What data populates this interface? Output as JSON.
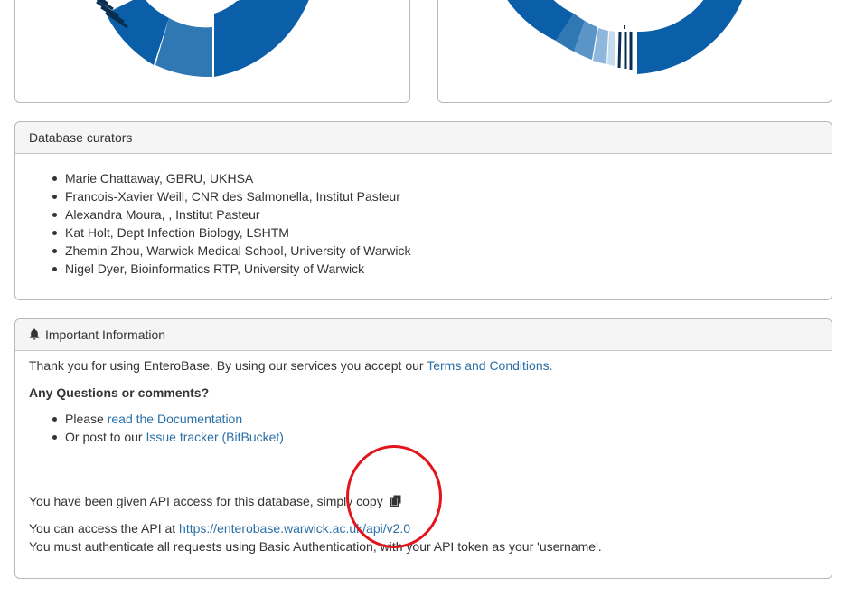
{
  "curators_panel": {
    "heading": "Database curators",
    "items": [
      "Marie Chattaway, GBRU, UKHSA",
      "Francois-Xavier Weill, CNR des Salmonella, Institut Pasteur",
      "Alexandra Moura, , Institut Pasteur",
      "Kat Holt, Dept Infection Biology, LSHTM",
      "Zhemin Zhou, Warwick Medical School, University of Warwick",
      "Nigel Dyer, Bioinformatics RTP, University of Warwick"
    ]
  },
  "info_panel": {
    "heading": "Important Information",
    "heading_icon": "bell-icon",
    "thanks_text": "Thank you for using EnteroBase. By using our services you accept our ",
    "terms_link": "Terms and Conditions.",
    "questions_heading": "Any Questions or comments?",
    "list": [
      {
        "prefix": "Please ",
        "link": "read the Documentation"
      },
      {
        "prefix": "Or post to our ",
        "link": "Issue tracker (BitBucket)"
      }
    ],
    "api_access_text": "You have been given API access for this database, simply copy",
    "copy_icon": "copy-icon",
    "api_url_prefix": "You can access the API at ",
    "api_url": "https://enterobase.warwick.ac.uk/api/v2.0",
    "auth_text": "You must authenticate all requests using Basic Authentication, with your API token as your 'username'."
  },
  "colors": {
    "link": "#2a6ea6",
    "donut_dark_blue": "#0b5ea8",
    "donut_navy": "#0a2e52",
    "annotation_red": "#e2141c",
    "heading_bg": "#f5f5f5"
  }
}
